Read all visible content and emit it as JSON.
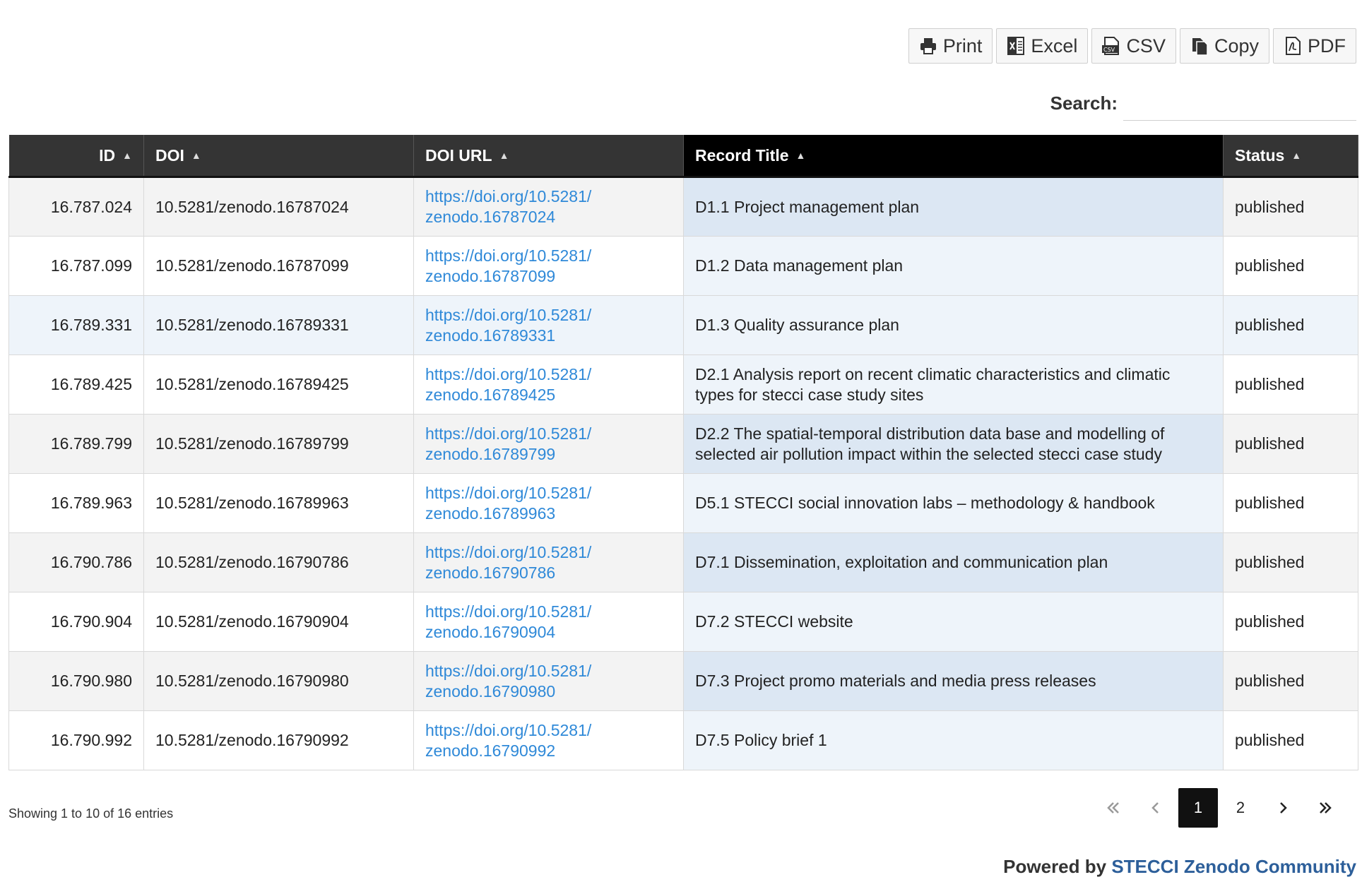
{
  "toolbar": {
    "buttons": [
      {
        "label": "Print",
        "icon": "printer-icon"
      },
      {
        "label": "Excel",
        "icon": "excel-icon"
      },
      {
        "label": "CSV",
        "icon": "csv-icon"
      },
      {
        "label": "Copy",
        "icon": "copy-icon"
      },
      {
        "label": "PDF",
        "icon": "pdf-icon"
      }
    ]
  },
  "search": {
    "label": "Search:",
    "value": ""
  },
  "table": {
    "columns": [
      "ID",
      "DOI",
      "DOI URL",
      "Record Title",
      "Status"
    ],
    "sorted_column": "Record Title",
    "rows": [
      {
        "id": "16.787.024",
        "doi": "10.5281/zenodo.16787024",
        "url_line1": "https://doi.org/10.5281/",
        "url_line2": "zenodo.16787024",
        "title": "D1.1 Project management plan",
        "status": "published"
      },
      {
        "id": "16.787.099",
        "doi": "10.5281/zenodo.16787099",
        "url_line1": "https://doi.org/10.5281/",
        "url_line2": "zenodo.16787099",
        "title": "D1.2 Data management plan",
        "status": "published"
      },
      {
        "id": "16.789.331",
        "doi": "10.5281/zenodo.16789331",
        "url_line1": "https://doi.org/10.5281/",
        "url_line2": "zenodo.16789331",
        "title": "D1.3 Quality assurance plan",
        "status": "published"
      },
      {
        "id": "16.789.425",
        "doi": "10.5281/zenodo.16789425",
        "url_line1": "https://doi.org/10.5281/",
        "url_line2": "zenodo.16789425",
        "title": "D2.1 Analysis report on recent climatic characteristics and climatic types for stecci case study sites",
        "status": "published"
      },
      {
        "id": "16.789.799",
        "doi": "10.5281/zenodo.16789799",
        "url_line1": "https://doi.org/10.5281/",
        "url_line2": "zenodo.16789799",
        "title": "D2.2 The spatial-temporal distribution data base and modelling of selected air pollution impact within the selected stecci case study",
        "status": "published"
      },
      {
        "id": "16.789.963",
        "doi": "10.5281/zenodo.16789963",
        "url_line1": "https://doi.org/10.5281/",
        "url_line2": "zenodo.16789963",
        "title": "D5.1 STECCI social innovation labs – methodology & handbook",
        "status": "published"
      },
      {
        "id": "16.790.786",
        "doi": "10.5281/zenodo.16790786",
        "url_line1": "https://doi.org/10.5281/",
        "url_line2": "zenodo.16790786",
        "title": "D7.1 Dissemination, exploitation and communication plan",
        "status": "published"
      },
      {
        "id": "16.790.904",
        "doi": "10.5281/zenodo.16790904",
        "url_line1": "https://doi.org/10.5281/",
        "url_line2": "zenodo.16790904",
        "title": "D7.2 STECCI website",
        "status": "published"
      },
      {
        "id": "16.790.980",
        "doi": "10.5281/zenodo.16790980",
        "url_line1": "https://doi.org/10.5281/",
        "url_line2": "zenodo.16790980",
        "title": "D7.3 Project promo materials and media press releases",
        "status": "published"
      },
      {
        "id": "16.790.992",
        "doi": "10.5281/zenodo.16790992",
        "url_line1": "https://doi.org/10.5281/",
        "url_line2": "zenodo.16790992",
        "title": "D7.5 Policy brief 1",
        "status": "published"
      }
    ]
  },
  "info": {
    "text": "Showing 1 to 10 of 16 entries"
  },
  "pagination": {
    "pages": [
      "1",
      "2"
    ],
    "current": "1"
  },
  "footer": {
    "powered_prefix": "Powered by",
    "powered_link": "STECCI Zenodo Community"
  },
  "colors": {
    "header_bg": "#343434",
    "link": "#2f89d8",
    "footer_link": "#2d5f9a"
  }
}
